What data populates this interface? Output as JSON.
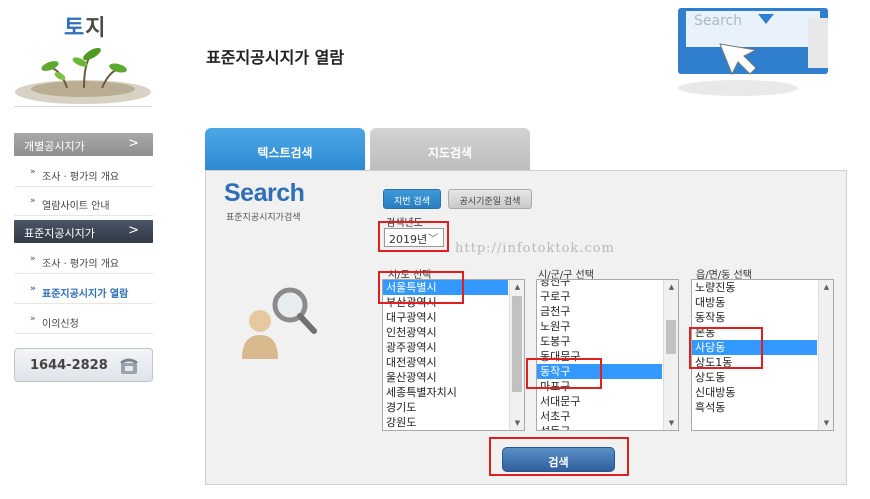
{
  "sidebar": {
    "logo_title_1": "토",
    "logo_title_2": "지",
    "sections": [
      {
        "label": "개별공시지가",
        "chevron": ">"
      },
      {
        "label": "표준지공시지가",
        "chevron": ">"
      }
    ],
    "items_section1": [
      {
        "label": "조사 · 평가의 개요",
        "bullet": "»"
      },
      {
        "label": "열람사이트 안내",
        "bullet": "»"
      }
    ],
    "items_section2": [
      {
        "label": "조사 · 평가의 개요",
        "bullet": "»"
      },
      {
        "label": "표준지공시지가 열람",
        "bullet": "»"
      },
      {
        "label": "이의신청",
        "bullet": "»"
      }
    ],
    "phone": "1644-2828"
  },
  "header": {
    "page_title": "표준지공시지가 열람"
  },
  "tabs": [
    {
      "label": "텍스트검색"
    },
    {
      "label": "지도검색"
    }
  ],
  "panel": {
    "search_word": "Search",
    "search_sub": "표준지공시지가검색",
    "buttons": {
      "jibun": "지번 검색",
      "gosi_date": "공시기준일 검색",
      "search": "검색"
    },
    "year_label": "검색년도",
    "year_value": "2019년",
    "watermark": "http://infotoktok.com",
    "sido_label": "시/도 선택",
    "sigungu_label": "시/군/구 선택",
    "dong_label": "읍/면/동 선택",
    "sido_list": [
      "서울특별시",
      "부산광역시",
      "대구광역시",
      "인천광역시",
      "광주광역시",
      "대전광역시",
      "울산광역시",
      "세종특별자치시",
      "경기도",
      "강원도"
    ],
    "sido_selected": "서울특별시",
    "sigungu_list": [
      "광진구",
      "구로구",
      "금천구",
      "노원구",
      "도봉구",
      "동대문구",
      "동작구",
      "마포구",
      "서대문구",
      "서초구",
      "성동구"
    ],
    "sigungu_selected": "동작구",
    "dong_list": [
      "노량진동",
      "대방동",
      "동작동",
      "본동",
      "사당동",
      "상도1동",
      "상도동",
      "신대방동",
      "흑석동"
    ],
    "dong_selected": "사당동"
  },
  "colors": {
    "accent_blue": "#2f6fb6",
    "tab_active": "#3b99dc",
    "highlight_red": "#e01f1f",
    "selection_blue": "#3399ff"
  }
}
